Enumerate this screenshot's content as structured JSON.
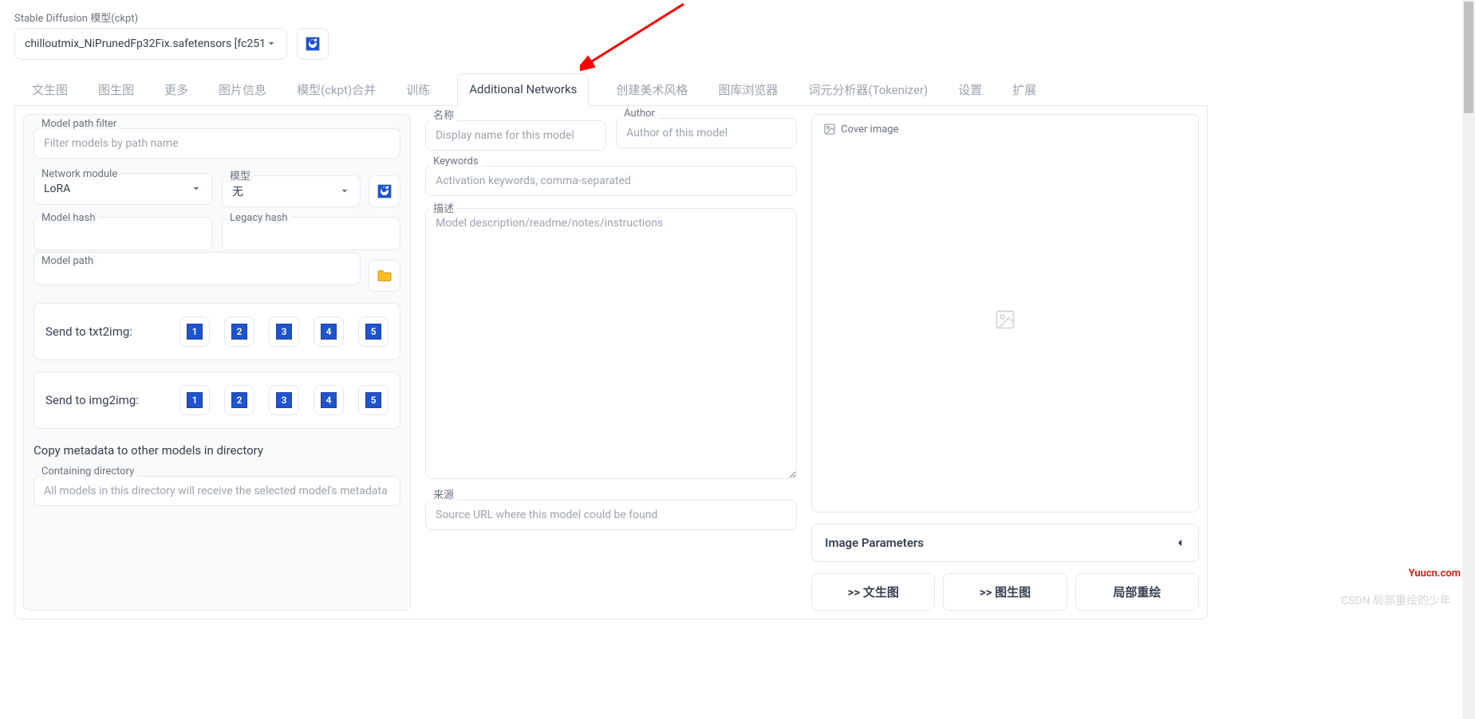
{
  "header": {
    "model_label": "Stable Diffusion 模型(ckpt)",
    "model_value": "chilloutmix_NiPrunedFp32Fix.safetensors [fc251"
  },
  "tabs": [
    "文生图",
    "图生图",
    "更多",
    "图片信息",
    "模型(ckpt)合并",
    "训练",
    "Additional Networks",
    "创建美术风格",
    "图库浏览器",
    "词元分析器(Tokenizer)",
    "设置",
    "扩展"
  ],
  "active_tab": "Additional Networks",
  "left": {
    "model_path_filter_label": "Model path filter",
    "model_path_filter_ph": "Filter models by path name",
    "network_module_label": "Network module",
    "network_module_value": "LoRA",
    "model_select_label": "模型",
    "model_select_value": "无",
    "model_hash_label": "Model hash",
    "legacy_hash_label": "Legacy hash",
    "model_path_label": "Model path",
    "send_txt2img": "Send to txt2img:",
    "send_img2img": "Send to img2img:",
    "nums": [
      "1",
      "2",
      "3",
      "4",
      "5"
    ],
    "copy_meta": "Copy metadata to other models in directory",
    "containing_dir_label": "Containing directory",
    "containing_dir_ph": "All models in this directory will receive the selected model's metadata"
  },
  "mid": {
    "name_label": "名称",
    "name_ph": "Display name for this model",
    "author_label": "Author",
    "author_ph": "Author of this model",
    "keywords_label": "Keywords",
    "keywords_ph": "Activation keywords, comma-separated",
    "desc_label": "描述",
    "desc_ph": "Model description/readme/notes/instructions",
    "source_label": "来源",
    "source_ph": "Source URL where this model could be found"
  },
  "right": {
    "cover_label": "Cover image",
    "accordion_label": "Image Parameters",
    "btn_txt2img": ">> 文生图",
    "btn_img2img": ">> 图生图",
    "btn_inpaint": "局部重绘"
  },
  "watermarks": {
    "w1": "Yuucn.com",
    "w2": "CSDN 局部重绘的少年"
  }
}
